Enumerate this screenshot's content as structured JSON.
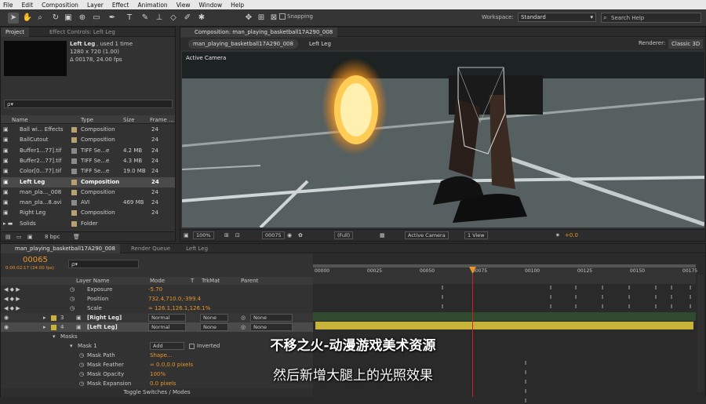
{
  "menu": [
    "File",
    "Edit",
    "Composition",
    "Layer",
    "Effect",
    "Animation",
    "View",
    "Window",
    "Help"
  ],
  "toolbar": {
    "snapping": "Snapping",
    "workspace_label": "Workspace:",
    "workspace_value": "Standard",
    "search_placeholder": "Search Help"
  },
  "project": {
    "tab_project": "Project",
    "tab_effects": "Effect Controls: Left Leg",
    "info_name": "Left Leg",
    "info_used": ", used 1 time",
    "info_dims": "1280 x 720 (1.00)",
    "info_dur": "Δ 00178, 24.00 fps",
    "search": "ρ▾",
    "columns": [
      "Name",
      "Type",
      "Size",
      "Frame ..."
    ],
    "items": [
      {
        "name": "Ball wi... Effects",
        "type": "Composition",
        "size": "",
        "fps": "24",
        "kind": "comp"
      },
      {
        "name": "BallCutout",
        "type": "Composition",
        "size": "",
        "fps": "24",
        "kind": "comp"
      },
      {
        "name": "Buffer1...77].tif",
        "type": "TIFF Se...e",
        "size": "4.2 MB",
        "fps": "24",
        "kind": "file"
      },
      {
        "name": "Buffer2...77].tif",
        "type": "TIFF Se...e",
        "size": "4.3 MB",
        "fps": "24",
        "kind": "file"
      },
      {
        "name": "Color[0...77].tif",
        "type": "TIFF Se...e",
        "size": "19.0 MB",
        "fps": "24",
        "kind": "file"
      },
      {
        "name": "Left Leg",
        "type": "Composition",
        "size": "",
        "fps": "24",
        "kind": "comp",
        "selected": true
      },
      {
        "name": "man_pla..._008",
        "type": "Composition",
        "size": "",
        "fps": "24",
        "kind": "comp"
      },
      {
        "name": "man_pla...8.avi",
        "type": "AVI",
        "size": "469 MB",
        "fps": "24",
        "kind": "file"
      },
      {
        "name": "Right Leg",
        "type": "Composition",
        "size": "",
        "fps": "24",
        "kind": "comp"
      },
      {
        "name": "Solids",
        "type": "Folder",
        "size": "",
        "fps": "",
        "kind": "folder"
      }
    ],
    "bpc": "8 bpc"
  },
  "comp": {
    "tab": "Composition: man_playing_basketball17A290_008",
    "breadcrumb1": "man_playing_basketball17A290_008",
    "breadcrumb2": "Left Leg",
    "renderer_label": "Renderer:",
    "renderer": "Classic 3D",
    "camera": "Active Camera",
    "zoom": "100%",
    "frame": "00075",
    "quality": "(Full)",
    "view_camera": "Active Camera",
    "views": "1 View",
    "exposure": "+0.0"
  },
  "timeline": {
    "tab1": "man_playing_basketball17A290_008",
    "tab2": "Render Queue",
    "tab3": "Left Leg",
    "timecode": "00065",
    "timecode_sub": "0:00:02:17 (24.00 fps)",
    "ruler": [
      "00000",
      "00025",
      "00050",
      "00075",
      "00100",
      "00125",
      "00150",
      "00175"
    ],
    "cols": {
      "layer": "Layer Name",
      "mode": "Mode",
      "t": "T",
      "trkmat": "TrkMat",
      "parent": "Parent"
    },
    "rows": [
      {
        "label": "Exposure",
        "value": "-5.70"
      },
      {
        "label": "Position",
        "value": "732.4,710.0,-399.4"
      },
      {
        "label": "Scale",
        "value": "∞ 126.1,126.1,126.1%"
      }
    ],
    "layers": [
      {
        "num": "3",
        "name": "[Right Leg]",
        "mode": "Normal",
        "trk": "None",
        "parent": "None"
      },
      {
        "num": "4",
        "name": "[Left Leg]",
        "mode": "Normal",
        "trk": "None",
        "parent": "None"
      }
    ],
    "masks_label": "Masks",
    "mask_name": "Mask 1",
    "mask_mode": "Add",
    "inverted": "Inverted",
    "mask_props": [
      {
        "label": "Mask Path",
        "value": "Shape..."
      },
      {
        "label": "Mask Feather",
        "value": "∞ 0.0,0.0 pixels"
      },
      {
        "label": "Mask Opacity",
        "value": "100%"
      },
      {
        "label": "Mask Expansion",
        "value": "0.0 pixels"
      }
    ],
    "toggle": "Toggle Switches / Modes"
  },
  "subtitles": {
    "line1": "不移之火-动漫游戏美术资源",
    "line2": "然后新增大腿上的光照效果"
  },
  "colors": {
    "accent": "#e8952a",
    "layer_bar": "#c9b23a",
    "playhead": "#d02020"
  }
}
